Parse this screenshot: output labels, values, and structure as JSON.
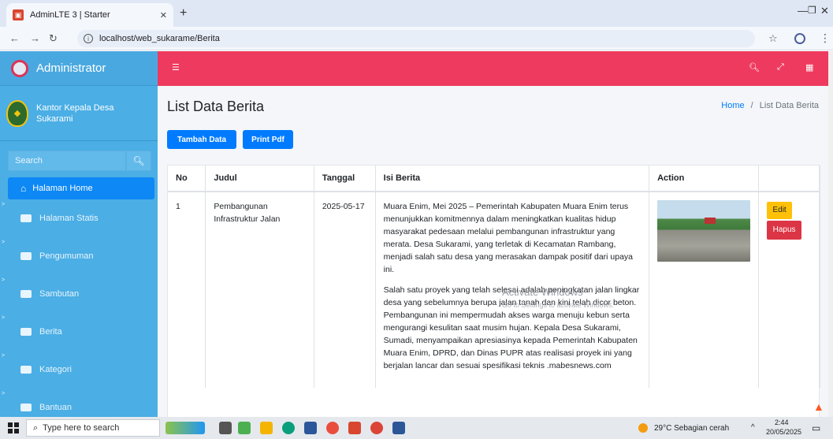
{
  "browser": {
    "tab_title": "AdminLTE 3 | Starter",
    "url": "localhost/web_sukarame/Berita"
  },
  "sidebar": {
    "brand": "Administrator",
    "user": "Kantor Kepala Desa Sukarami",
    "search_placeholder": "Search",
    "items": [
      {
        "label": "Halaman Home"
      },
      {
        "label": "Halaman Statis"
      },
      {
        "label": "Pengumuman"
      },
      {
        "label": "Sambutan"
      },
      {
        "label": "Berita"
      },
      {
        "label": "Kategori"
      },
      {
        "label": "Bantuan"
      }
    ]
  },
  "main": {
    "title": "List Data Berita",
    "breadcrumb_home": "Home",
    "breadcrumb_sep": "/",
    "breadcrumb_current": "List Data Berita",
    "btn_tambah": "Tambah Data",
    "btn_print": "Print Pdf",
    "table": {
      "headers": [
        "No",
        "Judul",
        "Tanggal",
        "Isi Berita",
        "Action",
        ""
      ],
      "rows": [
        {
          "no": "1",
          "judul": "Pembangunan Infrastruktur Jalan",
          "tanggal": "2025-05-17",
          "isi_p1": "Muara Enim, Mei 2025 – Pemerintah Kabupaten Muara Enim terus menunjukkan komitmennya dalam meningkatkan kualitas hidup masyarakat pedesaan melalui pembangunan infrastruktur yang merata. Desa Sukarami, yang terletak di Kecamatan Rambang, menjadi salah satu desa yang merasakan dampak positif dari upaya ini.",
          "isi_p2": "Salah satu proyek yang telah selesai adalah peningkatan jalan lingkar desa yang sebelumnya berupa jalan tanah dan kini telah dicor beton. Pembangunan ini mempermudah akses warga menuju kebun serta mengurangi kesulitan saat musim hujan. Kepala Desa Sukarami, Sumadi, menyampaikan apresiasinya kepada Pemerintah Kabupaten Muara Enim, DPRD, dan Dinas PUPR atas realisasi proyek ini yang berjalan lancar dan sesuai spesifikasi teknis .mabesnews.com",
          "btn_edit": "Edit",
          "btn_hapus": "Hapus"
        }
      ]
    }
  },
  "watermark": {
    "title": "Activate Windows",
    "subtitle": "Go to Settings to activate Windows."
  },
  "taskbar": {
    "search_placeholder": "Type here to search",
    "weather": "29°C  Sebagian cerah",
    "time": "2:44",
    "date": "20/05/2025"
  },
  "colors": {
    "sidebar": "#4baee5",
    "topbar": "#ee3a5e",
    "primary_button": "#007bff",
    "edit_button": "#ffc107",
    "delete_button": "#dc3545"
  }
}
